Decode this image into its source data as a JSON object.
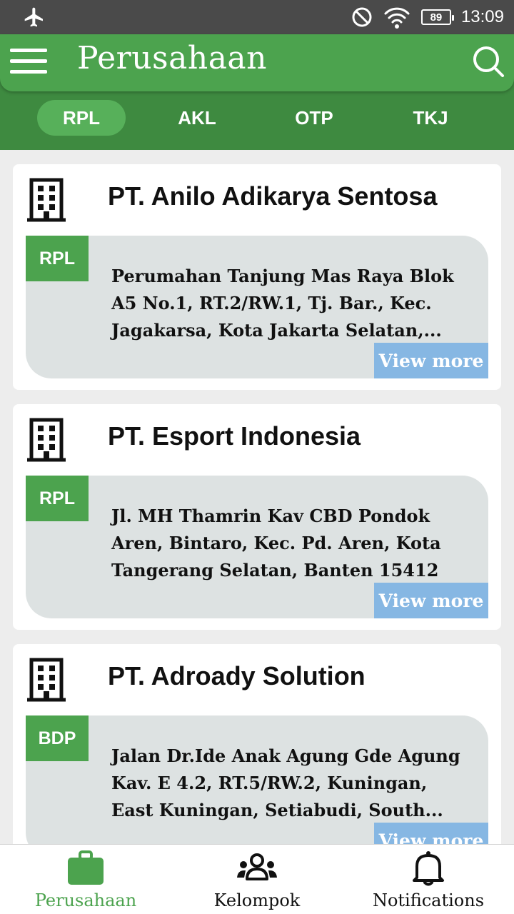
{
  "status_bar": {
    "time": "13:09",
    "battery": "89",
    "icons": [
      "airplane-mode-icon",
      "do-not-disturb-icon",
      "wifi-icon",
      "battery-icon"
    ]
  },
  "app_bar": {
    "title": "Perusahaan",
    "menu_icon": "hamburger-menu-icon",
    "search_icon": "search-icon"
  },
  "tabs": [
    {
      "label": "RPL",
      "active": true
    },
    {
      "label": "AKL",
      "active": false
    },
    {
      "label": "OTP",
      "active": false
    },
    {
      "label": "TKJ",
      "active": false
    }
  ],
  "companies": [
    {
      "name": "PT. Anilo Adikarya Sentosa",
      "badge": "RPL",
      "address": "Perumahan Tanjung Mas Raya Blok A5 No.1, RT.2/RW.1, Tj. Bar., Kec. Jagakarsa, Kota Jakarta Selatan,...",
      "view_more": "View more"
    },
    {
      "name": "PT. Esport Indonesia",
      "badge": "RPL",
      "address": "Jl. MH Thamrin Kav CBD Pondok Aren, Bintaro, Kec. Pd. Aren, Kota Tangerang Selatan, Banten 15412",
      "view_more": "View more"
    },
    {
      "name": "PT. Adroady Solution",
      "badge": "BDP",
      "address": "Jalan Dr.Ide Anak Agung Gde Agung Kav. E 4.2, RT.5/RW.2, Kuningan, East Kuningan, Setiabudi, South...",
      "view_more": "View more"
    }
  ],
  "bottom_nav": [
    {
      "label": "Perusahaan",
      "icon": "briefcase-icon",
      "active": true
    },
    {
      "label": "Kelompok",
      "icon": "group-icon",
      "active": false
    },
    {
      "label": "Notifications",
      "icon": "bell-icon",
      "active": false
    }
  ],
  "colors": {
    "primary": "#4ca34e",
    "tab_bar": "#3e8a40",
    "active_tab": "#57b05a",
    "view_more": "#86b7e3",
    "address_box": "#dde2e2",
    "background": "#ededed"
  }
}
